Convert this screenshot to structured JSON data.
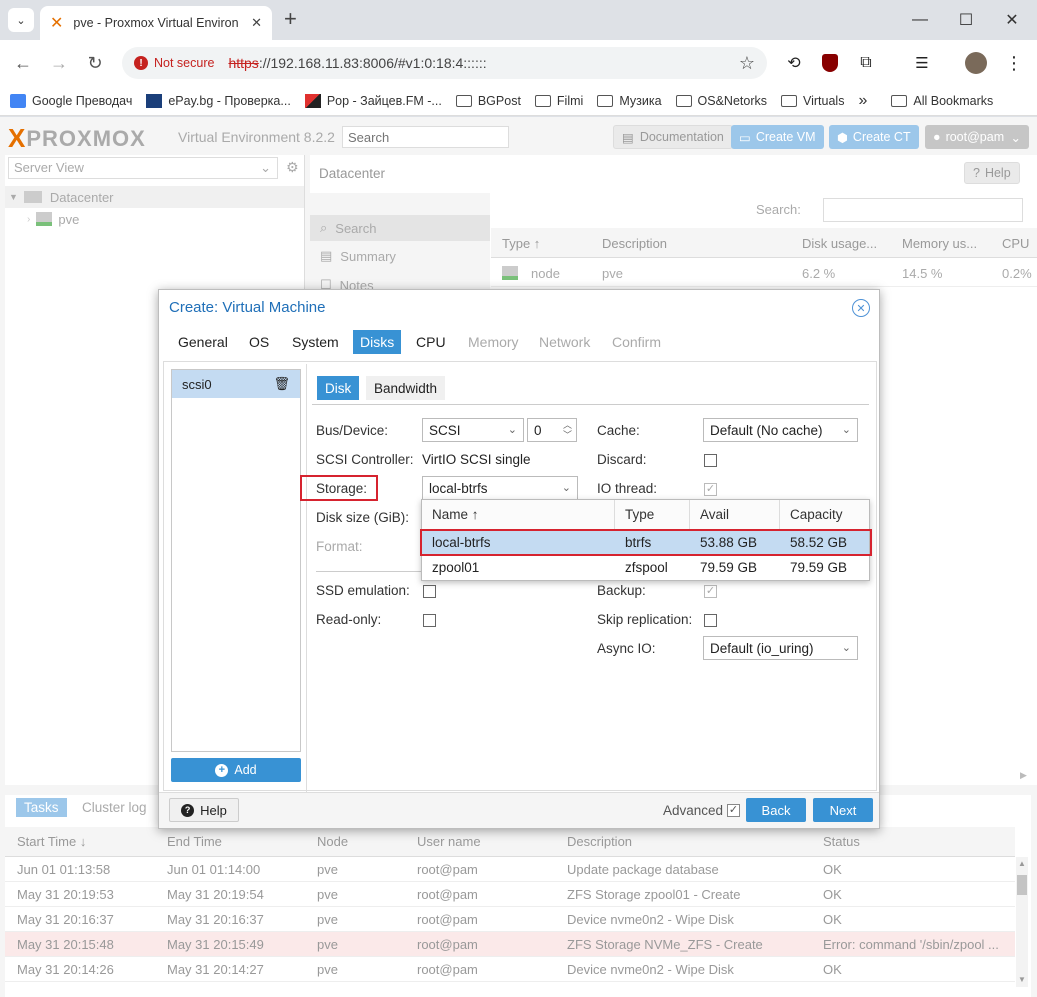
{
  "browser": {
    "tab_title": "pve - Proxmox Virtual Environment",
    "new_tab": "+",
    "security": "Not secure",
    "url_scheme": "https",
    "url_rest": "://192.168.11.83:8006/#v1:0:18:4::::::",
    "bookmarks": [
      {
        "label": "Google Преводач",
        "icon": "google-translate-icon"
      },
      {
        "label": "ePay.bg - Проверка...",
        "icon": "epay-icon"
      },
      {
        "label": "Pop - Зайцев.FM -...",
        "icon": "radio-icon"
      },
      {
        "label": "BGPost",
        "icon": "folder-icon"
      },
      {
        "label": "Filmi",
        "icon": "folder-icon"
      },
      {
        "label": "Музика",
        "icon": "folder-icon"
      },
      {
        "label": "OS&Netorks",
        "icon": "folder-icon"
      },
      {
        "label": "Virtuals",
        "icon": "folder-icon"
      }
    ],
    "more": "»",
    "all_bookmarks": "All Bookmarks"
  },
  "header": {
    "logo_x": "X",
    "logo": "PROXMOX",
    "product": "Virtual Environment 8.2.2",
    "search_placeholder": "Search",
    "documentation": "Documentation",
    "create_vm": "Create VM",
    "create_ct": "Create CT",
    "user": "root@pam"
  },
  "sidebar": {
    "view": "Server View",
    "datacenter": "Datacenter",
    "node": "pve"
  },
  "datacenter_panel": {
    "title": "Datacenter",
    "help": "Help",
    "menu": [
      "Search",
      "Summary",
      "Notes"
    ],
    "search_label": "Search:",
    "columns": [
      "Type ↑",
      "Description",
      "Disk usage...",
      "Memory us...",
      "CPU"
    ],
    "row": {
      "type": "node",
      "description": "pve",
      "disk": "6.2 %",
      "memory": "14.5 %",
      "cpu": "0.2%"
    }
  },
  "tasks": {
    "tabs": [
      "Tasks",
      "Cluster log"
    ],
    "columns": [
      "Start Time ↓",
      "End Time",
      "Node",
      "User name",
      "Description",
      "Status"
    ],
    "rows": [
      {
        "start": "Jun 01 01:13:58",
        "end": "Jun 01 01:14:00",
        "node": "pve",
        "user": "root@pam",
        "desc": "Update package database",
        "status": "OK"
      },
      {
        "start": "May 31 20:19:53",
        "end": "May 31 20:19:54",
        "node": "pve",
        "user": "root@pam",
        "desc": "ZFS Storage zpool01 - Create",
        "status": "OK"
      },
      {
        "start": "May 31 20:16:37",
        "end": "May 31 20:16:37",
        "node": "pve",
        "user": "root@pam",
        "desc": "Device nvme0n2 - Wipe Disk",
        "status": "OK"
      },
      {
        "start": "May 31 20:15:48",
        "end": "May 31 20:15:49",
        "node": "pve",
        "user": "root@pam",
        "desc": "ZFS Storage NVMe_ZFS - Create",
        "status": "Error: command '/sbin/zpool ..."
      },
      {
        "start": "May 31 20:14:26",
        "end": "May 31 20:14:27",
        "node": "pve",
        "user": "root@pam",
        "desc": "Device nvme0n2 - Wipe Disk",
        "status": "OK"
      }
    ]
  },
  "dialog": {
    "title": "Create: Virtual Machine",
    "tabs": [
      "General",
      "OS",
      "System",
      "Disks",
      "CPU",
      "Memory",
      "Network",
      "Confirm"
    ],
    "disk_item": "scsi0",
    "add": "Add",
    "subtabs": [
      "Disk",
      "Bandwidth"
    ],
    "fields": {
      "bus_label": "Bus/Device:",
      "bus_value": "SCSI",
      "bus_index": "0",
      "controller_label": "SCSI Controller:",
      "controller_value": "VirtIO SCSI single",
      "storage_label": "Storage:",
      "storage_value": "local-btrfs",
      "disksize_label": "Disk size (GiB):",
      "format_label": "Format:",
      "ssd_label": "SSD emulation:",
      "readonly_label": "Read-only:",
      "cache_label": "Cache:",
      "cache_value": "Default (No cache)",
      "discard_label": "Discard:",
      "iothread_label": "IO thread:",
      "backup_label": "Backup:",
      "skiprep_label": "Skip replication:",
      "asyncio_label": "Async IO:",
      "asyncio_value": "Default (io_uring)"
    },
    "storage_list": {
      "columns": [
        "Name ↑",
        "Type",
        "Avail",
        "Capacity"
      ],
      "rows": [
        {
          "name": "local-btrfs",
          "type": "btrfs",
          "avail": "53.88 GB",
          "capacity": "58.52 GB"
        },
        {
          "name": "zpool01",
          "type": "zfspool",
          "avail": "79.59 GB",
          "capacity": "79.59 GB"
        }
      ]
    },
    "help": "Help",
    "advanced": "Advanced",
    "back": "Back",
    "next": "Next"
  },
  "colors": {
    "accent": "#3892d4",
    "highlight": "#d6232f",
    "selection": "#c4dbf2",
    "brand": "#e57000"
  }
}
